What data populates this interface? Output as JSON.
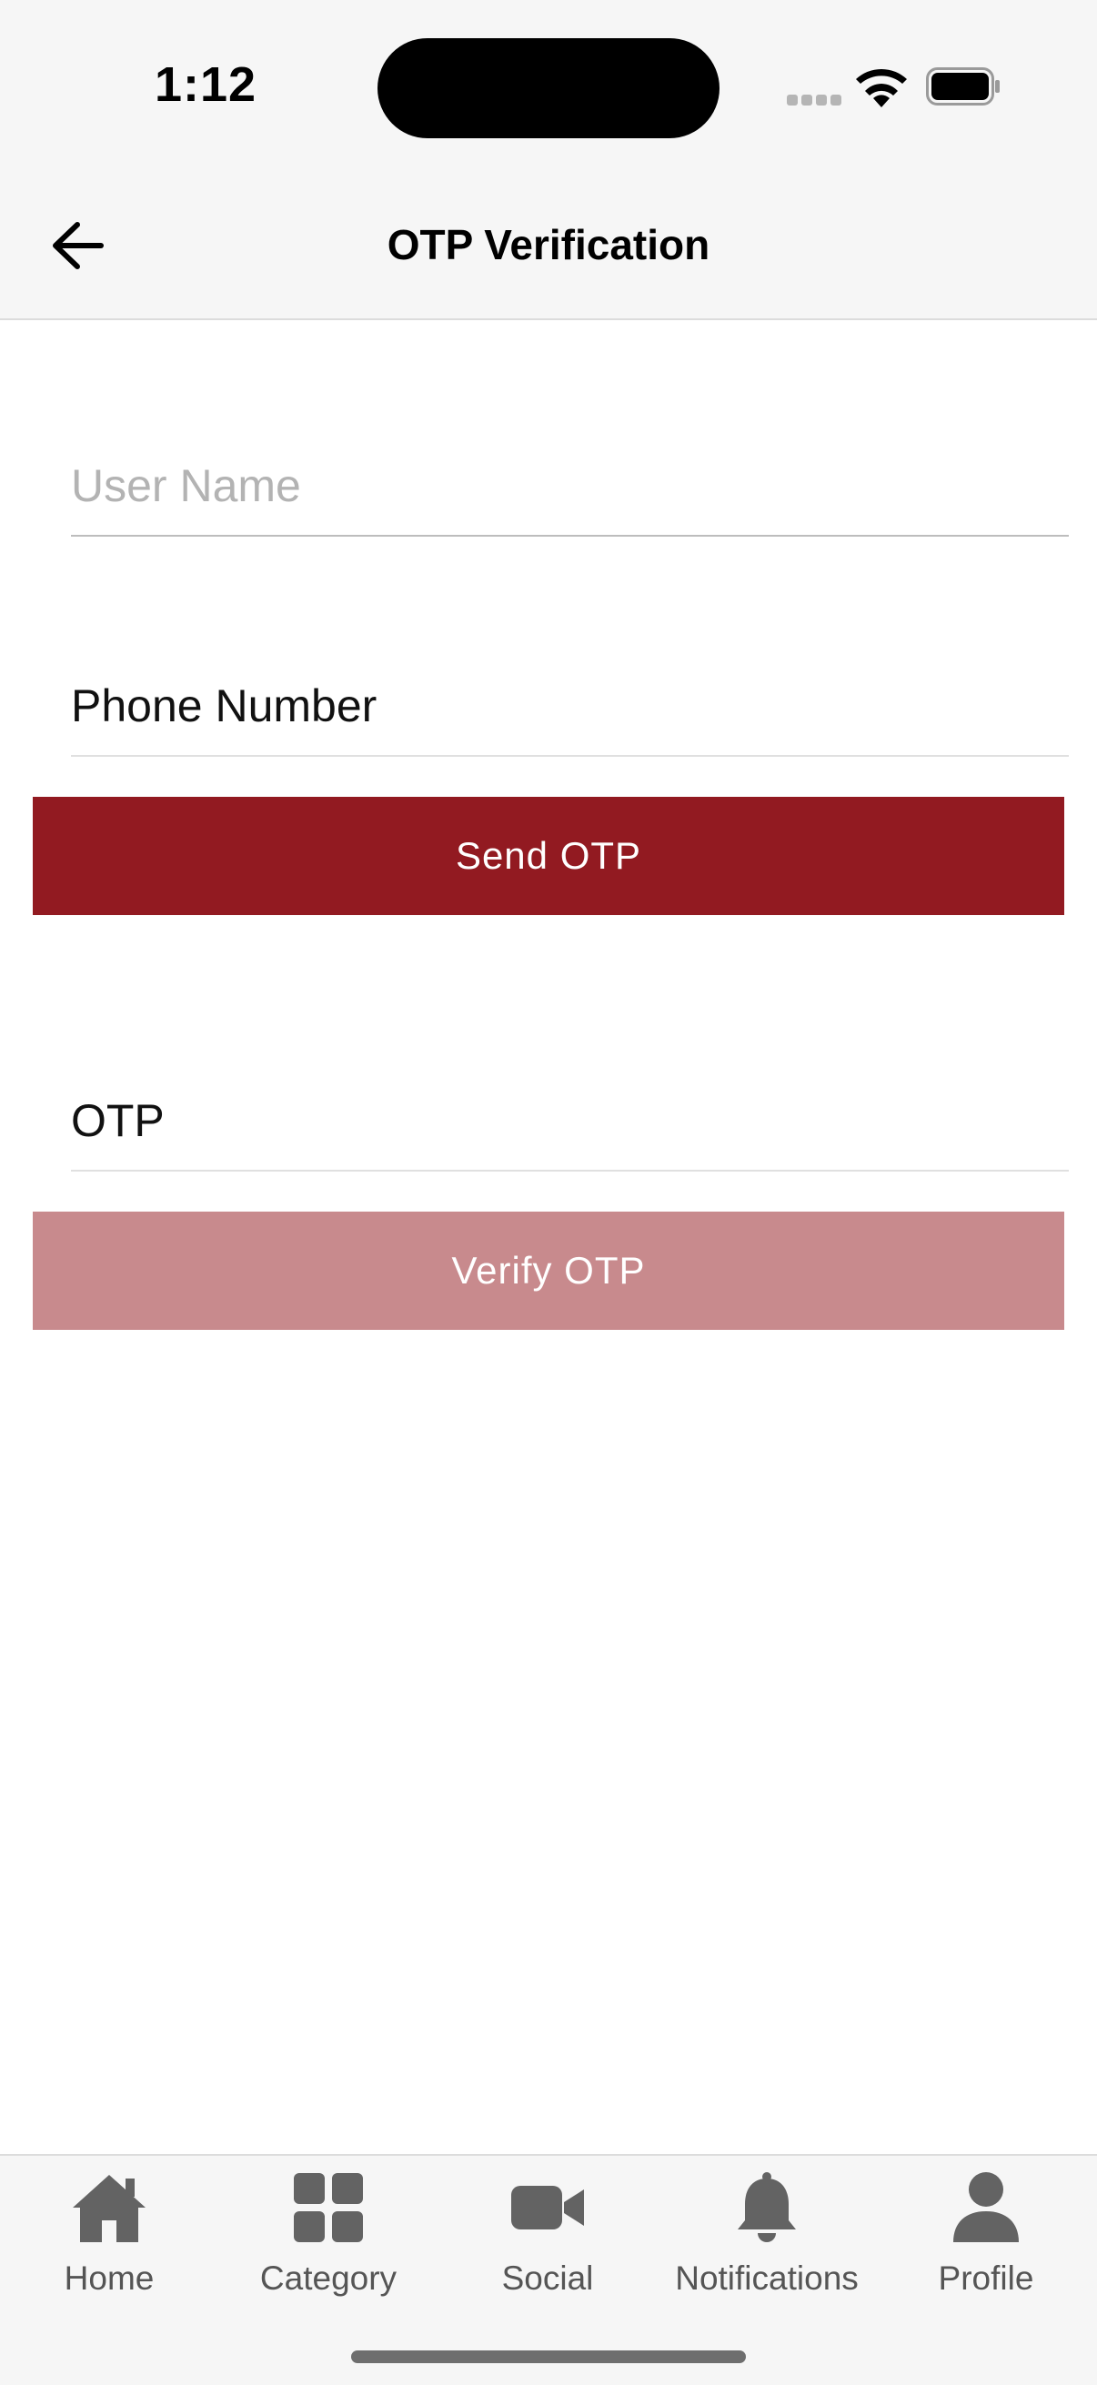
{
  "status_bar": {
    "time": "1:12"
  },
  "header": {
    "title": "OTP Verification",
    "back_icon": "arrow-left-icon"
  },
  "form": {
    "username": {
      "placeholder": "User Name",
      "value": ""
    },
    "phone": {
      "placeholder": "Phone Number",
      "value": ""
    },
    "send_otp_label": "Send OTP",
    "otp": {
      "placeholder": "OTP",
      "value": ""
    },
    "verify_otp_label": "Verify OTP"
  },
  "colors": {
    "primary": "#921a21",
    "primary_disabled": "#c88a8d",
    "bar_background": "#f6f6f6",
    "tab_icon": "#636363"
  },
  "tab_bar": {
    "items": [
      {
        "label": "Home",
        "icon": "home-icon"
      },
      {
        "label": "Category",
        "icon": "grid-icon"
      },
      {
        "label": "Social",
        "icon": "video-camera-icon"
      },
      {
        "label": "Notifications",
        "icon": "bell-icon"
      },
      {
        "label": "Profile",
        "icon": "person-icon"
      }
    ]
  }
}
